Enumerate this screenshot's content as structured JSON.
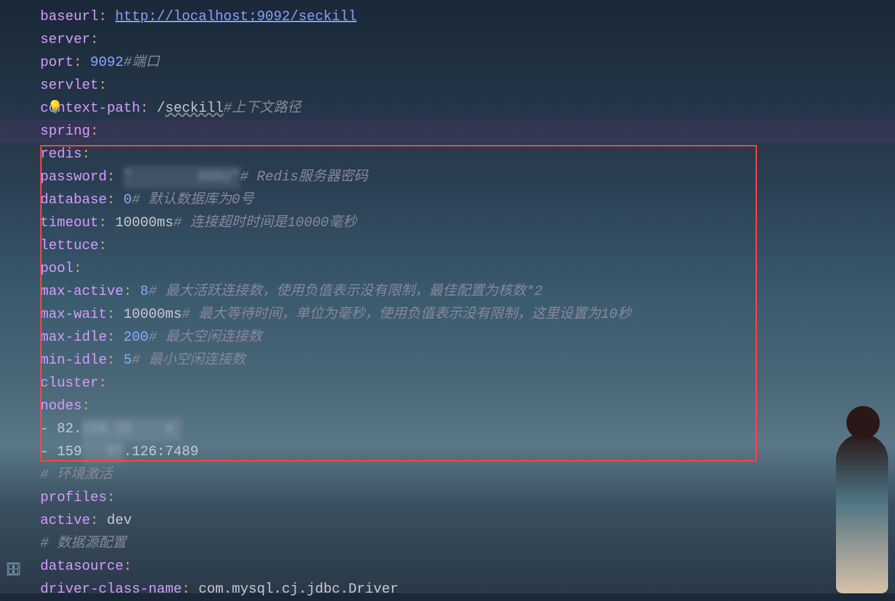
{
  "lines": {
    "baseurl_key": "baseurl",
    "baseurl_val": "http://localhost:9092/seckill",
    "server_key": "server",
    "port_key": "port",
    "port_val": "9092",
    "port_comment": "#端口",
    "servlet_key": "servlet",
    "context_path_key": "context-path",
    "context_path_slash": "/",
    "context_path_val": "seckill",
    "context_path_comment": "#上下文路径",
    "spring_key": "spring",
    "redis_key": "redis",
    "password_key": "password",
    "password_redacted": "\"        8082\"",
    "password_comment": "# Redis服务器密码",
    "database_key": "database",
    "database_val": "0",
    "database_comment": "# 默认数据库为0号",
    "timeout_key": "timeout",
    "timeout_val": "10000ms",
    "timeout_comment": "# 连接超时时间是10000毫秒",
    "lettuce_key": "lettuce",
    "pool_key": "pool",
    "max_active_key": "max-active",
    "max_active_val": "8",
    "max_active_comment": "# 最大活跃连接数，使用负值表示没有限制，最佳配置为核数*2",
    "max_wait_key": "max-wait",
    "max_wait_val": "10000ms",
    "max_wait_comment": "# 最大等待时间，单位为毫秒，使用负值表示没有限制，这里设置为10秒",
    "max_idle_key": "max-idle",
    "max_idle_val": "200",
    "max_idle_comment": "# 最大空闲连接数",
    "min_idle_key": "min-idle",
    "min_idle_val": "5",
    "min_idle_comment": "# 最小空闲连接数",
    "cluster_key": "cluster",
    "nodes_key": "nodes",
    "node1_prefix": "82.",
    "node1_redacted": "156.15    4 ",
    "node2_prefix": "159",
    "node2_redacted": "   97",
    "node2_suffix": ".126:7489",
    "profiles_comment": "# 环境激活",
    "profiles_key": "profiles",
    "active_key": "active",
    "active_val": "dev",
    "datasource_comment": "# 数据源配置",
    "datasource_key": "datasource",
    "driver_key": "driver-class-name",
    "driver_val": "com.mysql.cj.jdbc.Driver"
  },
  "icons": {
    "bulb": "💡",
    "db": "🗄"
  }
}
